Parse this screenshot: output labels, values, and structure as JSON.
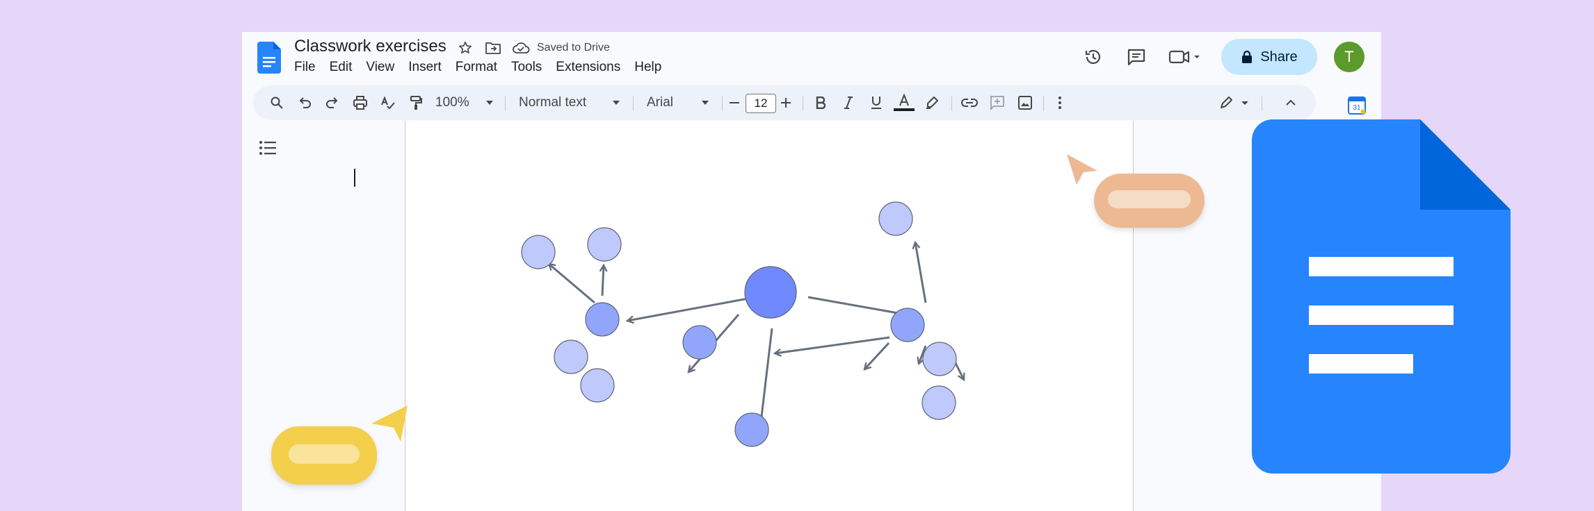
{
  "document": {
    "title": "Classwork exercises",
    "saved_status": "Saved to Drive"
  },
  "menu": [
    "File",
    "Edit",
    "View",
    "Insert",
    "Format",
    "Tools",
    "Extensions",
    "Help"
  ],
  "share": {
    "label": "Share"
  },
  "avatar": {
    "initial": "T",
    "color": "#5b9a2b"
  },
  "toolbar": {
    "zoom": "100%",
    "style": "Normal text",
    "font": "Arial",
    "font_size": "12"
  },
  "calendar": {
    "label": "31"
  },
  "icons": {
    "search": "search-icon",
    "undo": "undo-icon",
    "redo": "redo-icon",
    "print": "print-icon",
    "spellcheck": "spellcheck-icon",
    "paint_format": "paint-format-icon",
    "bold": "bold-icon",
    "italic": "italic-icon",
    "underline": "underline-icon",
    "text_color": "text-color-icon",
    "highlight": "highlight-icon",
    "link": "link-icon",
    "comment": "add-comment-icon",
    "image": "insert-image-icon",
    "more": "more-vert-icon",
    "edit_mode": "pencil-icon",
    "collapse": "chevron-up-icon",
    "outline": "outline-list-icon",
    "history": "history-icon",
    "comments": "comments-icon",
    "meet": "video-call-icon",
    "lock": "lock-icon"
  },
  "colors": {
    "background": "#e6d6fa",
    "accent": "#c2e7ff",
    "doc_blue": "#2684fc",
    "node_large": "#7189ff",
    "node_mid": "#91a6fb",
    "node_small": "#c0c9fb"
  }
}
